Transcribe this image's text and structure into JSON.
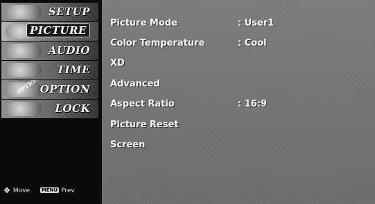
{
  "menu": {
    "tabs": [
      {
        "label": "SETUP",
        "active": false
      },
      {
        "label": "PICTURE",
        "active": true
      },
      {
        "label": "AUDIO",
        "active": false
      },
      {
        "label": "TIME",
        "active": false
      },
      {
        "label": "OPTION",
        "active": false
      },
      {
        "label": "LOCK",
        "active": false
      }
    ],
    "option_tag": "OPTION",
    "footer": {
      "move_label": "Move",
      "menu_key": "MENU",
      "prev_label": "Prev"
    }
  },
  "settings": [
    {
      "label": "Picture Mode",
      "value": ": User1"
    },
    {
      "label": "Color Temperature",
      "value": ": Cool"
    },
    {
      "label": "XD",
      "value": ""
    },
    {
      "label": "Advanced",
      "value": ""
    },
    {
      "label": "Aspect Ratio",
      "value": ": 16:9"
    },
    {
      "label": "Picture Reset",
      "value": ""
    },
    {
      "label": "Screen",
      "value": ""
    }
  ],
  "colors": {
    "sidebar_bg": "#0a0a0a",
    "panel_bg": "#727272",
    "text": "#f8f8f8"
  }
}
